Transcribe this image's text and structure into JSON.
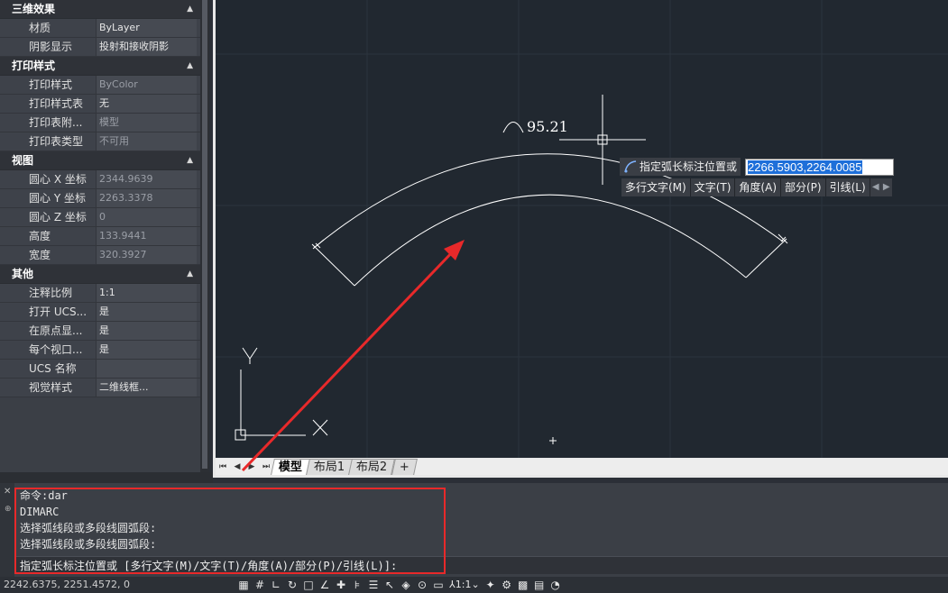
{
  "properties": {
    "sections": [
      {
        "title": "三维效果",
        "rows": [
          {
            "key": "材质",
            "value": "ByLayer",
            "gray": false
          },
          {
            "key": "阴影显示",
            "value": "投射和接收阴影",
            "gray": false
          }
        ]
      },
      {
        "title": "打印样式",
        "rows": [
          {
            "key": "打印样式",
            "value": "ByColor",
            "gray": true
          },
          {
            "key": "打印样式表",
            "value": "无",
            "gray": false
          },
          {
            "key": "打印表附...",
            "value": "模型",
            "gray": true
          },
          {
            "key": "打印表类型",
            "value": "不可用",
            "gray": true
          }
        ]
      },
      {
        "title": "视图",
        "rows": [
          {
            "key": "圆心 X 坐标",
            "value": "2344.9639",
            "gray": true
          },
          {
            "key": "圆心 Y 坐标",
            "value": "2263.3378",
            "gray": true
          },
          {
            "key": "圆心 Z 坐标",
            "value": "0",
            "gray": true
          },
          {
            "key": "高度",
            "value": "133.9441",
            "gray": true
          },
          {
            "key": "宽度",
            "value": "320.3927",
            "gray": true
          }
        ]
      },
      {
        "title": "其他",
        "rows": [
          {
            "key": "注释比例",
            "value": "1:1",
            "gray": false
          },
          {
            "key": "打开 UCS...",
            "value": "是",
            "gray": false
          },
          {
            "key": "在原点显...",
            "value": "是",
            "gray": false
          },
          {
            "key": "每个视口...",
            "value": "是",
            "gray": false
          },
          {
            "key": "UCS 名称",
            "value": "",
            "gray": false
          },
          {
            "key": "视觉样式",
            "value": "二维线框...",
            "gray": false
          }
        ]
      }
    ]
  },
  "drawing": {
    "dimension_text": "95.21",
    "ucs_y_label": "Y"
  },
  "dynamic_input": {
    "prompt": "指定弧长标注位置或",
    "value": "2266.5903,2264.0085",
    "options": [
      "多行文字(M)",
      "文字(T)",
      "角度(A)",
      "部分(P)",
      "引线(L)"
    ]
  },
  "layout_tabs": {
    "tabs": [
      "模型",
      "布局1",
      "布局2",
      "+"
    ],
    "active": "模型"
  },
  "command_line": {
    "history": [
      "命令:dar",
      "DIMARC",
      "选择弧线段或多段线圆弧段:",
      "选择弧线段或多段线圆弧段:"
    ],
    "current": "指定弧长标注位置或 [多行文字(M)/文字(T)/角度(A)/部分(P)/引线(L)]:"
  },
  "status_bar": {
    "coordinates": "2242.6375, 2251.4572, 0",
    "annotation_scale": "1:1"
  },
  "colors": {
    "viewport_bg": "#212830",
    "highlight": "#e8292a",
    "selection": "#1e6fd9"
  }
}
